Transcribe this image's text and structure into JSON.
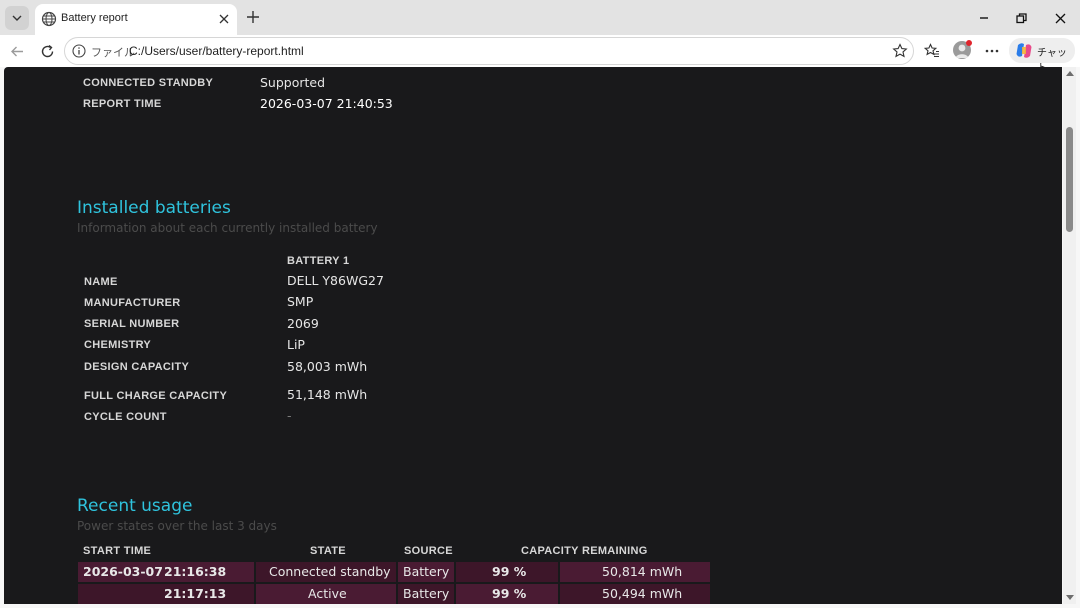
{
  "browser": {
    "tab_title": "Battery report",
    "omnibox_scheme": "ファイル",
    "url": "C:/Users/user/battery-report.html",
    "copilot_label": "チャット"
  },
  "report_header": [
    {
      "label": "CONNECTED STANDBY",
      "value": "Supported"
    },
    {
      "label": "REPORT TIME",
      "value": "2026-03-07  21:40:53"
    }
  ],
  "installed_batteries": {
    "title": "Installed batteries",
    "subtitle": "Information about each currently installed battery",
    "column_header": "BATTERY 1",
    "rows": [
      {
        "label": "NAME",
        "value": "DELL Y86WG27"
      },
      {
        "label": "MANUFACTURER",
        "value": "SMP"
      },
      {
        "label": "SERIAL NUMBER",
        "value": "2069"
      },
      {
        "label": "CHEMISTRY",
        "value": "LiP"
      },
      {
        "label": "DESIGN CAPACITY",
        "value": "58,003 mWh"
      },
      {
        "label": "FULL CHARGE CAPACITY",
        "value": "51,148 mWh"
      },
      {
        "label": "CYCLE COUNT",
        "value": "-"
      }
    ]
  },
  "recent_usage": {
    "title": "Recent usage",
    "subtitle": "Power states over the last 3 days",
    "headers": {
      "start_time": "START TIME",
      "state": "STATE",
      "source": "SOURCE",
      "capacity": "CAPACITY REMAINING"
    },
    "rows": [
      {
        "date": "2026-03-07",
        "time": "21:16:38",
        "state": "Connected standby",
        "source": "Battery",
        "percent": "99 %",
        "mwh": "50,814 mWh"
      },
      {
        "date": "",
        "time": "21:17:13",
        "state": "Active",
        "source": "Battery",
        "percent": "99 %",
        "mwh": "50,494 mWh"
      }
    ]
  },
  "colors": {
    "accent": "#2fc3dd",
    "page_background": "#19191b",
    "row_highlight": "#4a1b33"
  }
}
